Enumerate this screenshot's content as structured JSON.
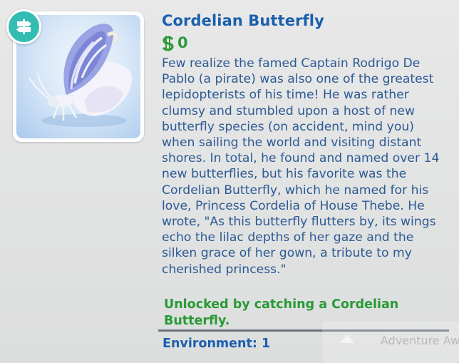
{
  "item": {
    "title": "Cordelian Butterfly",
    "price": "0",
    "description": "Few realize the famed Captain Rodrigo De Pablo (a pirate) was also one of the greatest lepidopterists of his time! He was rather clumsy and stumbled upon a host of new butterfly species (on accident, mind you) when sailing the world and visiting distant shores. In total, he found and named over 14 new butterflies, but his favorite was the Cordelian Butterfly, which he named for his love, Princess Cordelia of House Thebe. He wrote, \"As this butterfly flutters by, its wings echo the lilac depths of her gaze and the silken grace of her gown, a tribute to my cherished princess.\"",
    "unlock_text": "Unlocked by catching a Cordelian Butterfly.",
    "environment_label": "Environment: 1",
    "badge_icon": "signpost-icon",
    "currency_icon": "simoleon-icon"
  },
  "background_tooltip": {
    "text": "Adventure Aw"
  },
  "colors": {
    "title": "#1b5fae",
    "description": "#2c5a94",
    "price": "#2f9a3a",
    "unlock": "#289a35",
    "badge": "#33bdb2"
  }
}
